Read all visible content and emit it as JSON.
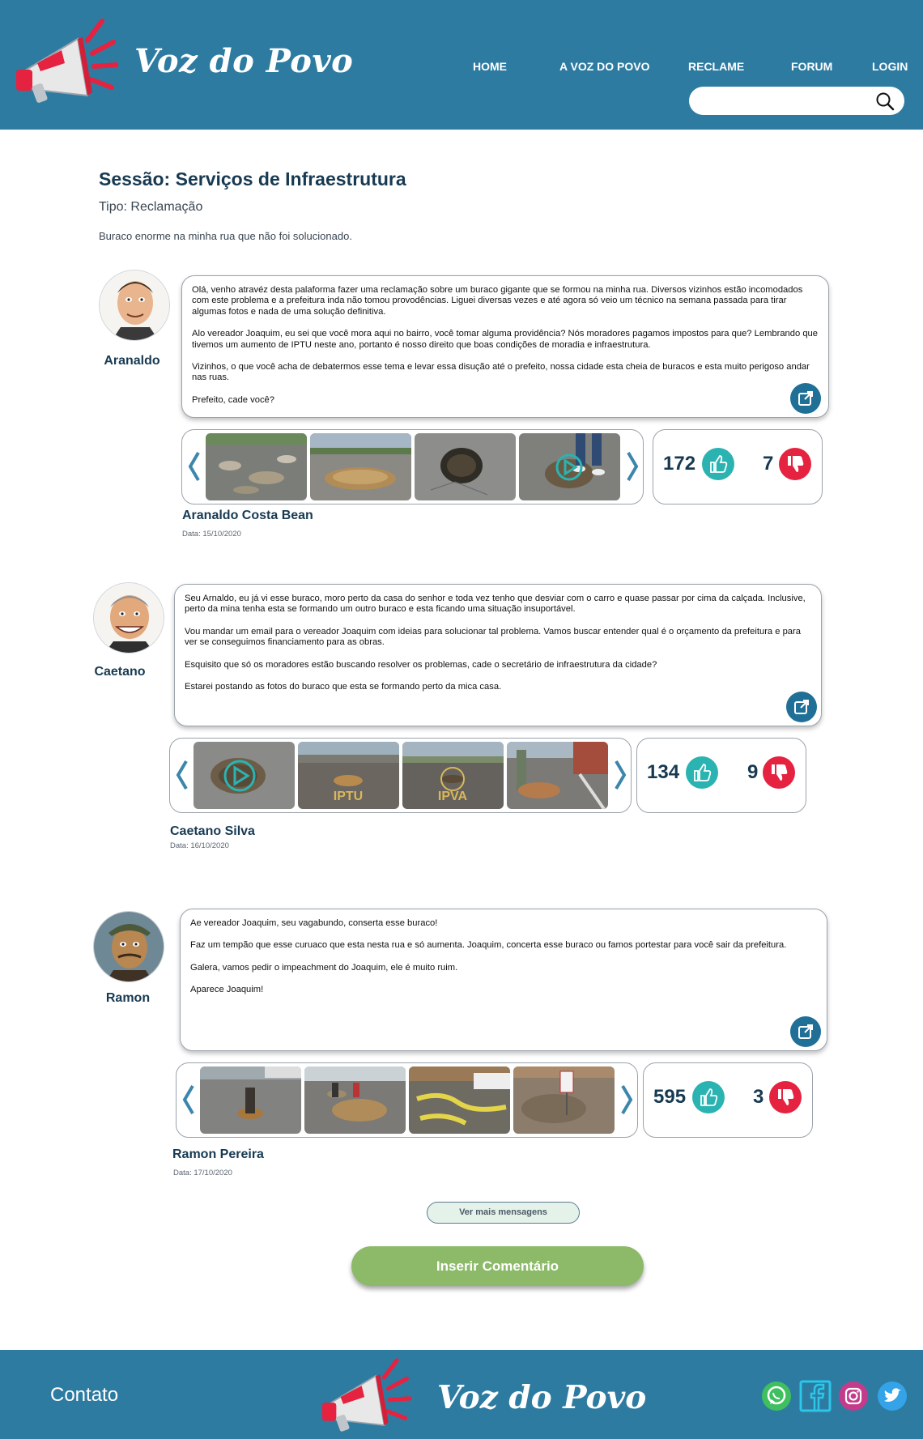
{
  "header": {
    "brand": "Voz do Povo",
    "nav": [
      "HOME",
      "A VOZ DO POVO",
      "RECLAME",
      "FORUM",
      "LOGIN"
    ],
    "search": {
      "value": "",
      "placeholder": ""
    },
    "colors": {
      "header_bg": "#2e7ba1"
    }
  },
  "session": {
    "title": "Sessão: Serviços de Infraestrutura",
    "type": "Tipo: Reclamação",
    "description": "Buraco enorme na minha rua que não foi solucionado."
  },
  "posts": [
    {
      "author_short": "Aranaldo",
      "author_full": "Aranaldo Costa Bean",
      "date": "Data: 15/10/2020",
      "paragraphs": [
        "Olá, venho atravéz desta palaforma fazer uma reclamação sobre um buraco gigante que se formou na minha rua. Diversos vizinhos estão incomodados com este problema e a prefeitura inda não tomou provodências. Liguei diversas vezes e até agora só veio um técnico na semana passada para tirar algumas fotos e nada de uma solução definitiva.",
        "Alo vereador Joaquim, eu sei que você mora aqui no bairro, você tomar alguma providência? Nós moradores pagamos impostos para que? Lembrando que tivemos um aumento de IPTU neste ano,  portanto é nosso direito que boas condições de moradia e infraestrutura.",
        "Vizinhos, o que você acha de debatermos esse tema e levar essa disução até o prefeito, nossa cidade esta cheia de buracos e esta muito perigoso andar nas ruas.",
        "Prefeito, cade você?"
      ],
      "likes": "172",
      "dislikes": "7"
    },
    {
      "author_short": "Caetano",
      "author_full": "Caetano Silva",
      "date": "Data: 16/10/2020",
      "paragraphs": [
        "Seu Arnaldo, eu já vi esse buraco, moro perto da casa do senhor e toda vez tenho que desviar com o carro e quase passar por cima da calçada. Inclusive, perto da mina tenha esta se formando um outro buraco e esta ficando uma situação insuportável.",
        "Vou mandar um email para o vereador Joaquim com ideias para solucionar tal problema. Vamos buscar entender qual é o orçamento da prefeitura e para ver se conseguimos financiamento para as obras.",
        "Esquisito que só os moradores estão buscando resolver os problemas, cade o secretário de infraestrutura da cidade?",
        "Estarei postando as fotos do buraco que esta se formando perto da mica casa."
      ],
      "likes": "134",
      "dislikes": "9",
      "photo_texts": [
        "IPTU",
        "IPVA"
      ]
    },
    {
      "author_short": "Ramon",
      "author_full": "Ramon Pereira",
      "date": "Data: 17/10/2020",
      "paragraphs": [
        "Ae vereador Joaquim, seu vagabundo, conserta esse buraco!",
        "Faz um tempão que esse curuaco que esta nesta rua e só aumenta. Joaquim, concerta esse buraco ou famos portestar para você sair da prefeitura.",
        "Galera, vamos pedir o impeachment do Joaquim, ele é muito ruim.",
        "Aparece Joaquim!"
      ],
      "likes": "595",
      "dislikes": "3"
    }
  ],
  "actions": {
    "more_messages": "Ver mais mensagens",
    "insert_comment": "Inserir Comentário"
  },
  "footer": {
    "contact": "Contato",
    "brand": "Voz do Povo",
    "social": [
      "whatsapp-icon",
      "facebook-icon",
      "instagram-icon",
      "twitter-icon"
    ]
  },
  "colors": {
    "accent": "#2e7ba1",
    "like": "#2bb3b1",
    "dislike": "#e5223f",
    "insert_button": "#8cba69"
  }
}
